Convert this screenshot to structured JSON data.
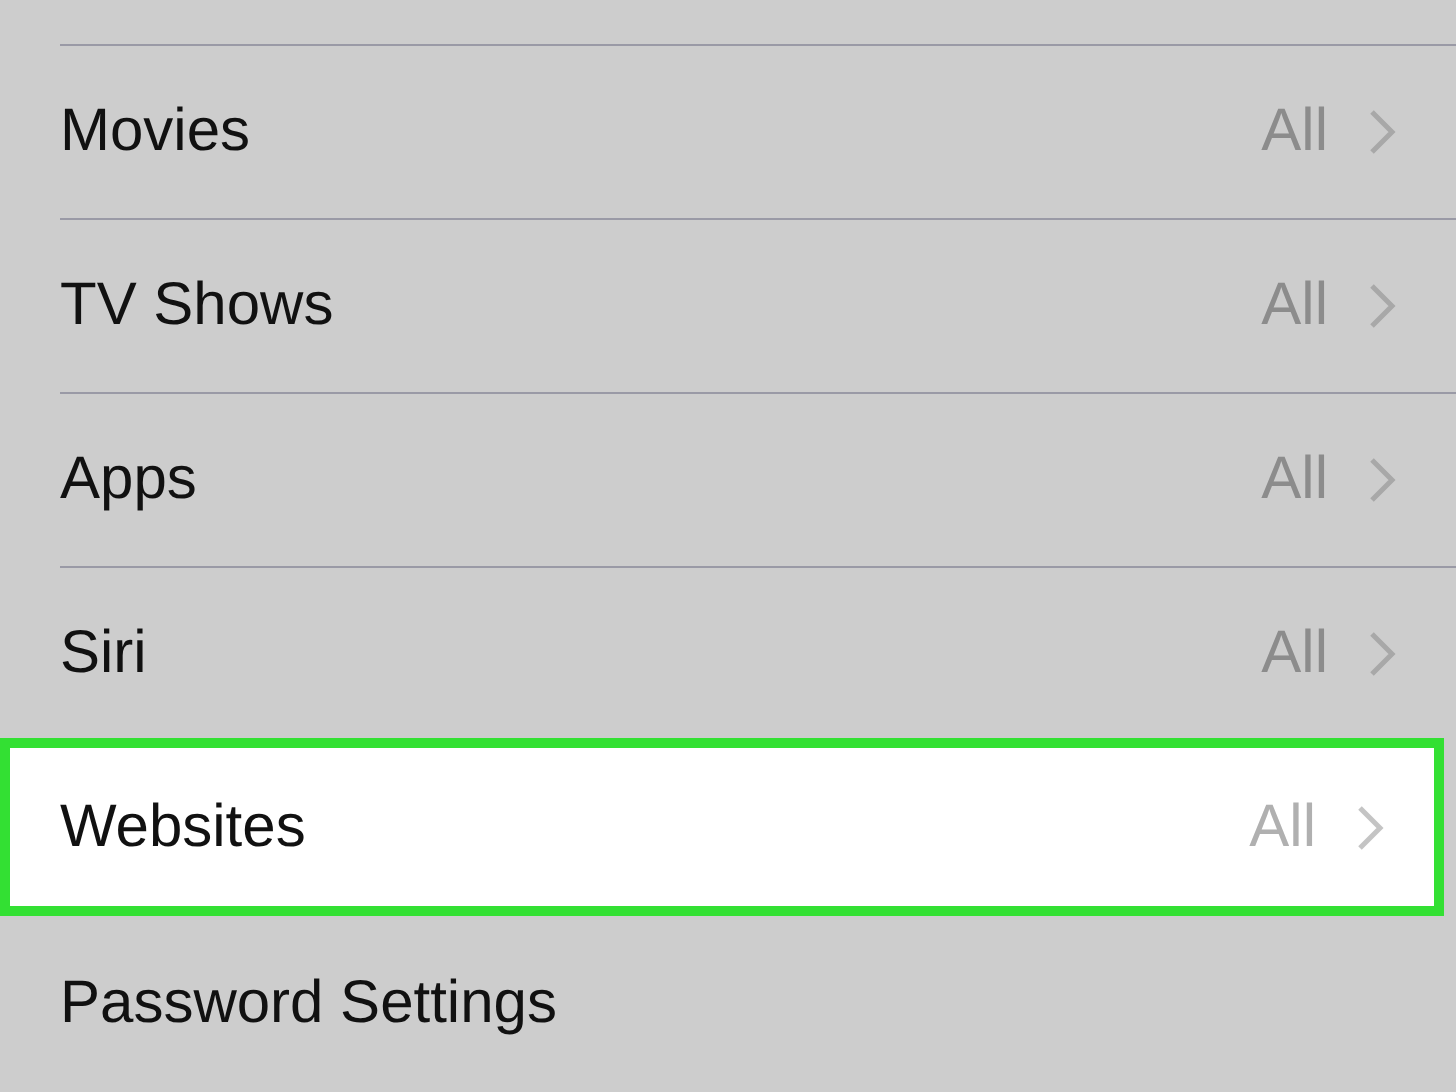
{
  "rows": [
    {
      "label": "Movies",
      "value": "All",
      "chevron": true,
      "highlighted": false
    },
    {
      "label": "TV Shows",
      "value": "All",
      "chevron": true,
      "highlighted": false
    },
    {
      "label": "Apps",
      "value": "All",
      "chevron": true,
      "highlighted": false
    },
    {
      "label": "Siri",
      "value": "All",
      "chevron": true,
      "highlighted": false
    },
    {
      "label": "Websites",
      "value": "All",
      "chevron": true,
      "highlighted": true
    },
    {
      "label": "Password Settings",
      "chevron": false,
      "highlighted": false
    }
  ]
}
